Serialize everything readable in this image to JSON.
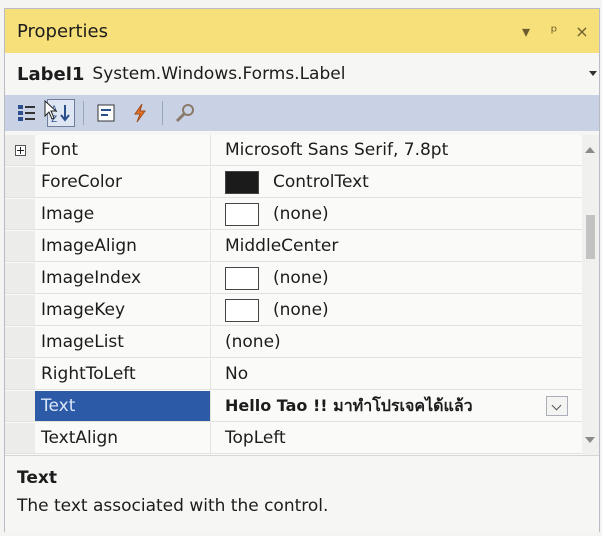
{
  "window": {
    "title": "Properties",
    "buttons": [
      "▾",
      "ᵖ",
      "×"
    ]
  },
  "selector": {
    "object_name": "Label1",
    "object_type": "System.Windows.Forms.Label"
  },
  "toolbar": {
    "tools": [
      "categorized-icon",
      "alphabetical-icon",
      "properties-icon",
      "events-icon",
      "property-pages-icon"
    ]
  },
  "grid": {
    "rows": [
      {
        "name": "Font",
        "value": "Microsoft Sans Serif, 7.8pt",
        "expander": true
      },
      {
        "name": "ForeColor",
        "value": "ControlText",
        "swatch": "dark"
      },
      {
        "name": "Image",
        "value": "(none)",
        "swatch": "light"
      },
      {
        "name": "ImageAlign",
        "value": "MiddleCenter"
      },
      {
        "name": "ImageIndex",
        "value": "(none)",
        "swatch": "light"
      },
      {
        "name": "ImageKey",
        "value": "(none)",
        "swatch": "light"
      },
      {
        "name": "ImageList",
        "value": "(none)"
      },
      {
        "name": "RightToLeft",
        "value": "No"
      },
      {
        "name": "Text",
        "value": "Hello Tao !! มาทำโปรเจคได้แล้ว",
        "selected": true
      },
      {
        "name": "TextAlign",
        "value": "TopLeft"
      }
    ]
  },
  "description": {
    "title": "Text",
    "text": "The text associated with the control."
  },
  "colors": {
    "title_bar": "#f7e07a",
    "toolbar": "#c8d2e4",
    "selected_row": "#2c5aa6"
  }
}
